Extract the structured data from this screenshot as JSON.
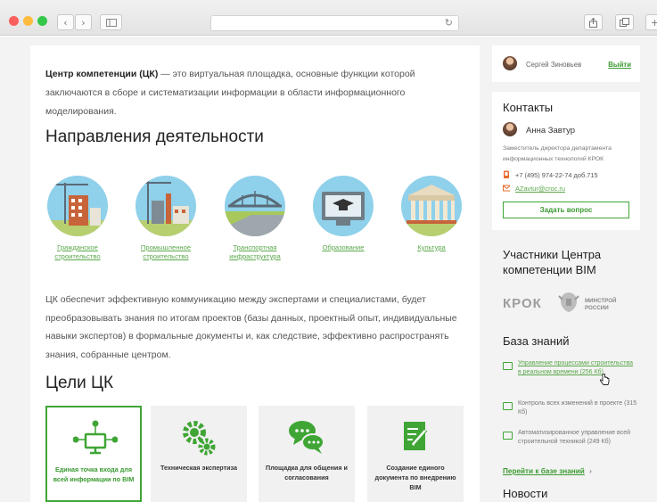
{
  "browser": {
    "share_icon": "share-icon",
    "tabs_icon": "tabs-icon",
    "new_tab": "+"
  },
  "intro": {
    "bold": "Центр компетенции (ЦК)",
    "rest": " — это виртуальная площадка, основные функции которой заключаются в сборе и систематизации информации в области информационного моделирования."
  },
  "directions": {
    "title": "Направления деятельности",
    "items": [
      {
        "label": "Гражданское строительство",
        "icon": "residential-construction-icon"
      },
      {
        "label": "Промышленное строительство",
        "icon": "industrial-construction-icon"
      },
      {
        "label": "Транспортная инфраструктура",
        "icon": "bridge-icon"
      },
      {
        "label": "Образование",
        "icon": "graduation-cap-icon"
      },
      {
        "label": "Культура",
        "icon": "theatre-building-icon"
      }
    ]
  },
  "paragraph": "ЦК обеспечит эффективную коммуникацию между экспертами и специалистами, будет преобразовывать знания по итогам проектов (базы данных, проектный опыт, индивидуальные навыки экспертов) в формальные документы и, как следствие, эффективно распространять знания, собранные центром.",
  "goals": {
    "title": "Цели ЦК",
    "items": [
      {
        "label": "Единая точка входа для всей информации по BIM",
        "icon": "monitor-network-icon"
      },
      {
        "label": "Техническая экспертиза",
        "icon": "gears-icon"
      },
      {
        "label": "Площадка для общения и согласования",
        "icon": "chat-bubbles-icon"
      },
      {
        "label": "Создание единого документа по внедрению BIM",
        "icon": "document-edit-icon"
      }
    ]
  },
  "sidebar": {
    "user": {
      "name": "Сергей Зиновьев",
      "exit": "Выйти"
    },
    "contacts": {
      "title": "Контакты",
      "name": "Анна Завтур",
      "position": "Заместитель директора департамента информационных технологий КРОК",
      "phone": "+7 (495) 974-22-74 доб.715",
      "email": "AZavtur@croc.ru",
      "button": "Задать вопрос"
    },
    "participants": {
      "title": "Участники Центра компетенции BIM",
      "croc": "КРОК",
      "minstroy": "МИНСТРОЙ РОССИИ"
    },
    "knowledge": {
      "title": "База знаний",
      "items": [
        "Управление процессами строительства в реальном времени (256 Кб)",
        "Контроль всех изменений в проекте (315 Кб)",
        "Автоматизированное управление всей строительной техникой (249 Кб)"
      ],
      "link": "Перейти к базе знаний",
      "link_arrow": "›"
    },
    "news": {
      "title": "Новости"
    }
  },
  "colors": {
    "accent": "#3fa535",
    "link": "#5aa84a",
    "page_bg": "#f3f3f3"
  }
}
